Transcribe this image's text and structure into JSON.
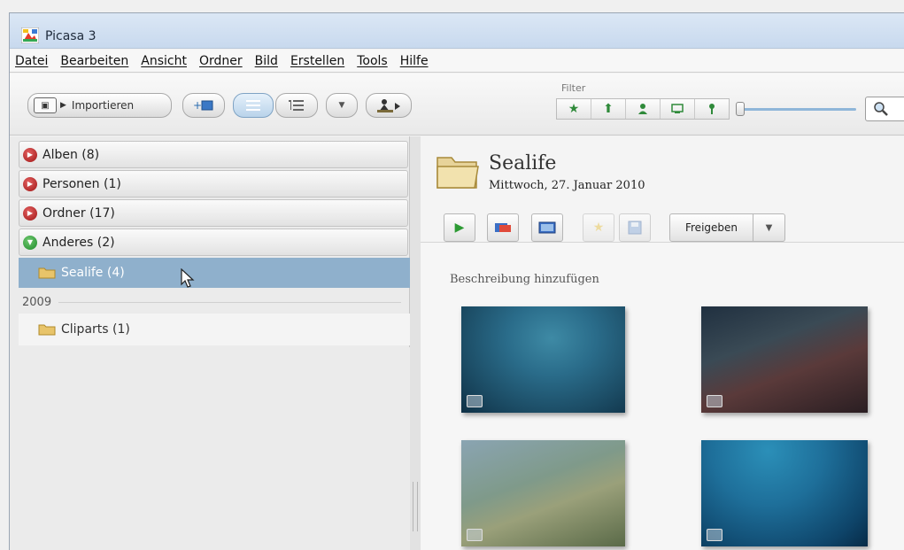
{
  "window": {
    "title": "Picasa 3"
  },
  "menu": [
    "Datei",
    "Bearbeiten",
    "Ansicht",
    "Ordner",
    "Bild",
    "Erstellen",
    "Tools",
    "Hilfe"
  ],
  "toolbar": {
    "import_label": "Importieren",
    "filter_label": "Filter"
  },
  "left_pane": {
    "groups": [
      {
        "label": "Alben (8)",
        "state": "collapsed"
      },
      {
        "label": "Personen (1)",
        "state": "collapsed"
      },
      {
        "label": "Ordner (17)",
        "state": "collapsed"
      },
      {
        "label": "Anderes (2)",
        "state": "expanded"
      }
    ],
    "selected_folder": "Sealife (4)",
    "year": "2009",
    "folders_2009": [
      "Cliparts (1)"
    ]
  },
  "album": {
    "title": "Sealife",
    "date": "Mittwoch, 27. Januar 2010",
    "share_label": "Freigeben",
    "description_placeholder": "Beschreibung hinzufügen"
  },
  "colors": {
    "selection": "#8fb0cc",
    "accent_green": "#2f8a3a",
    "collapse_red": "#a01515"
  }
}
